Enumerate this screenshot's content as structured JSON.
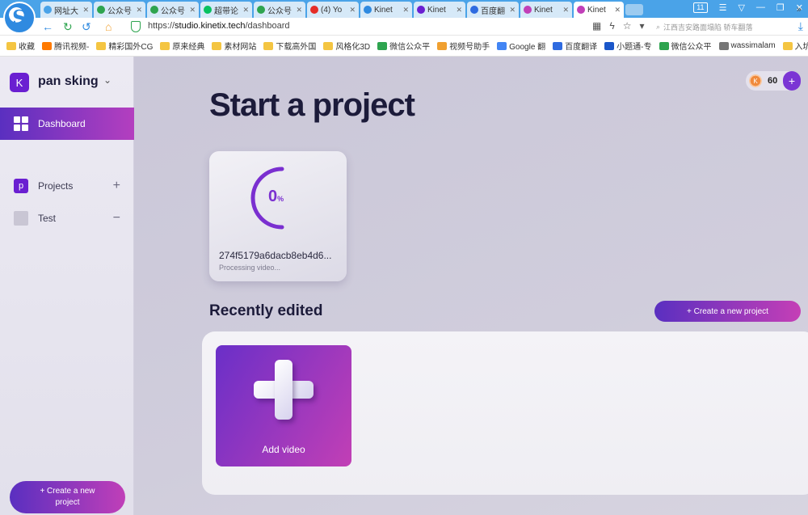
{
  "browser": {
    "tabs": [
      {
        "title": "网址大",
        "color": "#4aa3e8"
      },
      {
        "title": "公众号",
        "color": "#2ea44f"
      },
      {
        "title": "公众号",
        "color": "#2ea44f"
      },
      {
        "title": "超带论",
        "color": "#07c160"
      },
      {
        "title": "公众号",
        "color": "#2ea44f"
      },
      {
        "title": "(4) Yo",
        "color": "#e52d27"
      },
      {
        "title": "Kinet",
        "color": "#2f8ae0"
      },
      {
        "title": "Kinet",
        "color": "#6a1fd1"
      },
      {
        "title": "百度翻",
        "color": "#2f6be0"
      },
      {
        "title": "Kinet",
        "color": "#c13fb8"
      },
      {
        "title": "Kinet",
        "color": "#c13fb8"
      }
    ],
    "window_count": "11",
    "url_prefix": "https://",
    "url_host": "studio.kinetix.tech",
    "url_path": "/dashboard",
    "search_placeholder": "江西吉安路面塌陷 轿车翻落",
    "bookmarks": [
      {
        "label": "收藏",
        "icon": "star-icon",
        "color": "#f4c542"
      },
      {
        "label": "腾讯视频-",
        "icon": "video-icon",
        "color": "#ff7a00"
      },
      {
        "label": "精彩国外CG",
        "icon": "folder-icon",
        "color": "#f4c542"
      },
      {
        "label": "原来经典",
        "icon": "folder-icon",
        "color": "#f4c542"
      },
      {
        "label": "素材网站",
        "icon": "folder-icon",
        "color": "#f4c542"
      },
      {
        "label": "下载高外国",
        "icon": "folder-icon",
        "color": "#f4c542"
      },
      {
        "label": "风格化3D",
        "icon": "folder-icon",
        "color": "#f4c542"
      },
      {
        "label": "微信公众平",
        "icon": "wechat-icon",
        "color": "#2ea44f"
      },
      {
        "label": "视频号助手",
        "icon": "channels-icon",
        "color": "#f0a030"
      },
      {
        "label": "Google 翻",
        "icon": "translate-icon",
        "color": "#4285f4"
      },
      {
        "label": "百度翻译",
        "icon": "translate-icon",
        "color": "#2f6be0"
      },
      {
        "label": "小题通-专",
        "icon": "app-icon",
        "color": "#1a56c9"
      },
      {
        "label": "微信公众平",
        "icon": "wechat-icon",
        "color": "#2ea44f"
      },
      {
        "label": "wassimalam",
        "icon": "page-icon",
        "color": "#777777"
      },
      {
        "label": "入坑BI",
        "icon": "folder-icon",
        "color": "#f4c542"
      }
    ]
  },
  "sidebar": {
    "workspace_initial": "K",
    "workspace_name": "pan sking",
    "dashboard_label": "Dashboard",
    "items": [
      {
        "label": "Projects",
        "icon_text": "p",
        "action": "+"
      },
      {
        "label": "Test",
        "icon_text": "",
        "action": "−"
      }
    ],
    "create_button_line1": "+ Create a new",
    "create_button_line2": "project"
  },
  "main": {
    "credits_initial": "K",
    "credits_count": "60",
    "credits_plus": "+",
    "page_title": "Start a project",
    "project_card": {
      "progress_value": "0",
      "progress_unit": "%",
      "name": "274f5179a6dacb8eb4d6...",
      "status": "Processing video..."
    },
    "recent_title": "Recently edited",
    "create_button": "+ Create a new project",
    "add_video_label": "Add video"
  },
  "colors": {
    "accent_start": "#5a2fc0",
    "accent_end": "#c03fb8",
    "title_text": "#1c1b3a",
    "progress_ring": "#7a2fd0"
  }
}
